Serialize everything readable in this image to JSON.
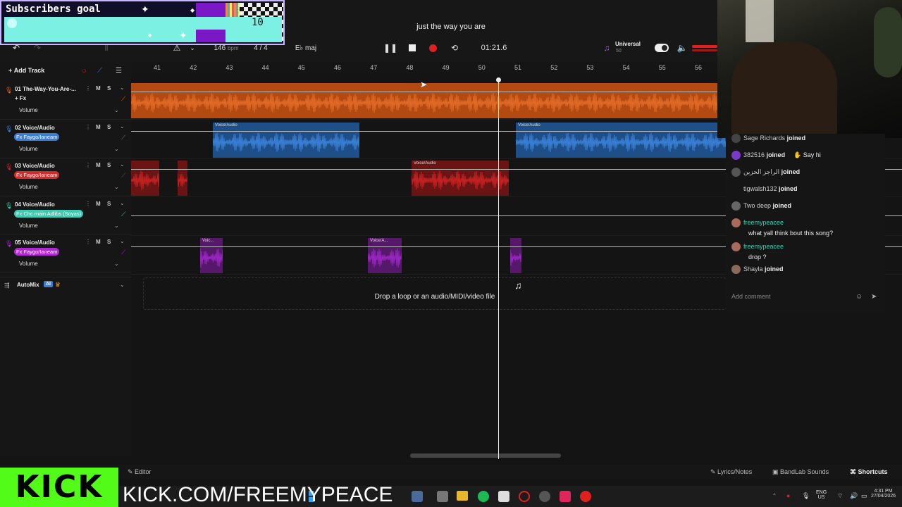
{
  "overlay": {
    "goal_title": "Subscribers goal",
    "goal_value": "10"
  },
  "topbar": {
    "song_title": "just the way you are",
    "bpm": "146",
    "bpm_unit": "bpm",
    "time_sig": "4 / 4",
    "key": "E♭ maj",
    "time": "01:21.6",
    "preset_name": "Universal",
    "preset_value": "50"
  },
  "ruler": {
    "bars": [
      "41",
      "42",
      "43",
      "44",
      "45",
      "46",
      "47",
      "48",
      "49",
      "50",
      "51",
      "52",
      "53",
      "54",
      "55",
      "56"
    ]
  },
  "tracks_header": {
    "add_track": "Add Track",
    "automix": "AutoMix",
    "ai_badge": "AI"
  },
  "tracks": [
    {
      "title": "01  The-Way-You-Are-...",
      "fx": "+ Fx",
      "volume": "Volume",
      "m": "M",
      "s": "S",
      "color": "#e0641c"
    },
    {
      "title": "02  Voice/Audio",
      "fx": "Fx Faygo/Ianeam",
      "volume": "Volume",
      "m": "M",
      "s": "S",
      "color": "#3a7fd5"
    },
    {
      "title": "03  Voice/Audio",
      "fx": "Fx Faygo/Ianeam",
      "volume": "Volume",
      "m": "M",
      "s": "S",
      "color": "#d42a2a"
    },
    {
      "title": "04  Voice/Audio",
      "fx": "Fx Chc main Adlibs (Soyas)",
      "volume": "Volume",
      "m": "M",
      "s": "S",
      "color": "#3ec9b0"
    },
    {
      "title": "05  Voice/Audio",
      "fx": "Fx Faygo/Ianeam",
      "volume": "Volume",
      "m": "M",
      "s": "S",
      "color": "#b028d6"
    }
  ],
  "clips": {
    "voice_audio": "Voice/Audio",
    "voic": "Voic...",
    "voice_a": "Voice/A..."
  },
  "drop_zone": {
    "text": "Drop a loop or an audio/MIDI/video file"
  },
  "chat": {
    "rows": [
      {
        "name": "Sage Richards",
        "msg": "joined"
      },
      {
        "name": "382516",
        "msg": "joined",
        "action": "Say hi"
      },
      {
        "name": "الراجز الحزين",
        "msg": "joined"
      },
      {
        "name": "tigwalsh132",
        "msg": "joined"
      },
      {
        "name": "Two deep",
        "msg": "joined"
      },
      {
        "name": "freemypeacee",
        "msg": "what yall think bout this song?"
      },
      {
        "name": "freemypeacee",
        "msg": "drop ?"
      },
      {
        "name": "Shayla",
        "msg": "joined"
      }
    ],
    "placeholder": "Add comment"
  },
  "footer": {
    "editor": "Editor",
    "lyrics": "Lyrics/Notes",
    "sounds": "BandLab Sounds",
    "shortcuts": "Shortcuts"
  },
  "taskbar": {
    "kick_logo": "KICK",
    "kick_url": "KICK.COM/FREEMYPEACE",
    "lang": "ENG",
    "region": "US",
    "clock": "4:31 PM",
    "date": "27/04/2026"
  },
  "colors": {
    "orange": "#e0641c",
    "blue": "#3a7fd5",
    "red": "#d42a2a",
    "teal": "#3ec9b0",
    "purple": "#b028d6",
    "kick_green": "#53fc18"
  }
}
